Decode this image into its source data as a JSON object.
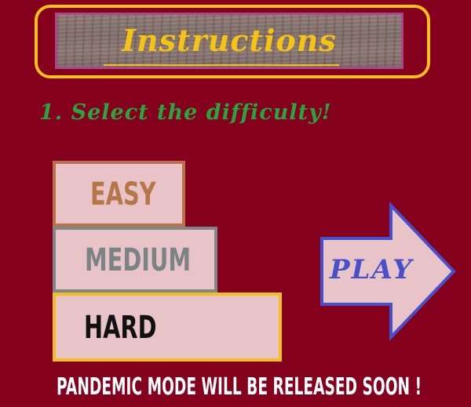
{
  "title": "Instructions",
  "step": "1. Select the difficulty!",
  "difficulty": {
    "easy": "EASY",
    "medium": "MEDIUM",
    "hard": "HARD"
  },
  "play_label": "PLAY",
  "footer": "PANDEMIC MODE WILL BE RELEASED SOON !",
  "colors": {
    "background": "#85001d",
    "title_gold": "#f4c313",
    "step_green": "#2ba340",
    "easy_border": "#b8714a",
    "medium_border": "#7f8688",
    "hard_border": "#f0c11c",
    "button_fill": "#e8c4c8",
    "play_blue": "#4750c8"
  }
}
